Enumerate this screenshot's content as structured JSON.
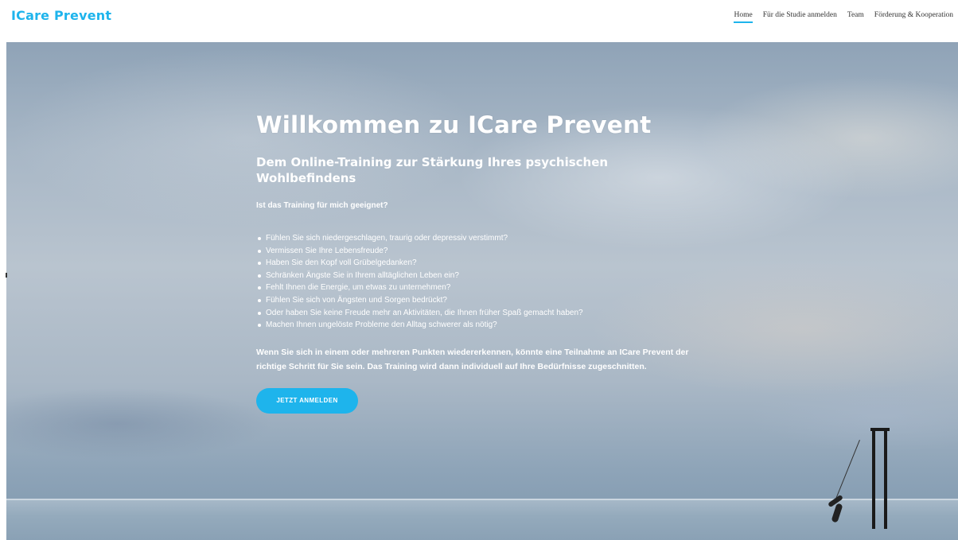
{
  "header": {
    "logo": "ICare Prevent",
    "nav": [
      {
        "label": "Home",
        "active": true
      },
      {
        "label": "Für die Studie anmelden",
        "active": false
      },
      {
        "label": "Team",
        "active": false
      },
      {
        "label": "Förderung & Kooperation",
        "active": false
      }
    ]
  },
  "hero": {
    "title": "Willkommen zu ICare Prevent",
    "subtitle": "Dem Online-Training zur Stärkung Ihres psychischen Wohlbefindens",
    "question": "Ist das Training für mich geeignet?",
    "bullets": [
      "Fühlen Sie sich niedergeschlagen, traurig oder depressiv verstimmt?",
      "Vermissen Sie Ihre Lebensfreude?",
      "Haben Sie den Kopf voll Grübelgedanken?",
      "Schränken Ängste Sie in Ihrem alltäglichen Leben ein?",
      "Fehlt Ihnen die Energie, um etwas zu unternehmen?",
      "Fühlen Sie sich von Ängsten und Sorgen bedrückt?",
      "Oder haben Sie keine Freude mehr an Aktivitäten, die Ihnen früher Spaß gemacht haben?",
      "Machen Ihnen ungelöste Probleme den Alltag schwerer als nötig?"
    ],
    "paragraph": "Wenn Sie sich in einem oder mehreren Punkten wiedererkennen, könnte eine Teilnahme an ICare Prevent der richtige Schritt für Sie sein. Das Training wird dann individuell auf Ihre Bedürfnisse zugeschnitten.",
    "cta_label": "JETZT ANMELDEN"
  },
  "colors": {
    "accent": "#1eb4ec",
    "nav_text": "#333333",
    "hero_text": "#ffffff"
  }
}
